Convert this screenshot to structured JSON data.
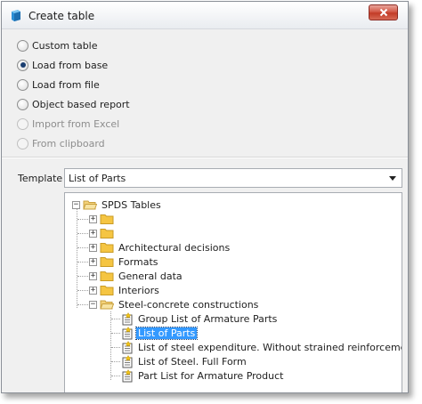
{
  "window": {
    "title": "Create table"
  },
  "options": {
    "items": [
      {
        "label": "Custom table",
        "checked": false,
        "enabled": true
      },
      {
        "label": "Load from base",
        "checked": true,
        "enabled": true
      },
      {
        "label": "Load from file",
        "checked": false,
        "enabled": true
      },
      {
        "label": "Object based report",
        "checked": false,
        "enabled": true
      },
      {
        "label": "Import from Excel",
        "checked": false,
        "enabled": false
      },
      {
        "label": "From clipboard",
        "checked": false,
        "enabled": false
      }
    ]
  },
  "template": {
    "label": "Template",
    "value": "List of Parts"
  },
  "tree": {
    "root": "SPDS Tables",
    "folders": [
      "",
      "",
      "Architectural decisions",
      "Formats",
      "General data",
      "Interiors"
    ],
    "open_folder": "Steel-concrete constructions",
    "items": [
      "Group List of Armature Parts",
      "List of Parts",
      "List of steel expenditure. Without strained reinforcements",
      "List of Steel. Full Form",
      "Part List for Armature Product"
    ],
    "selected_item": "List of Parts"
  },
  "colors": {
    "selection": "#3399ff",
    "folder": "#f5c542",
    "close_button": "#c94432"
  }
}
